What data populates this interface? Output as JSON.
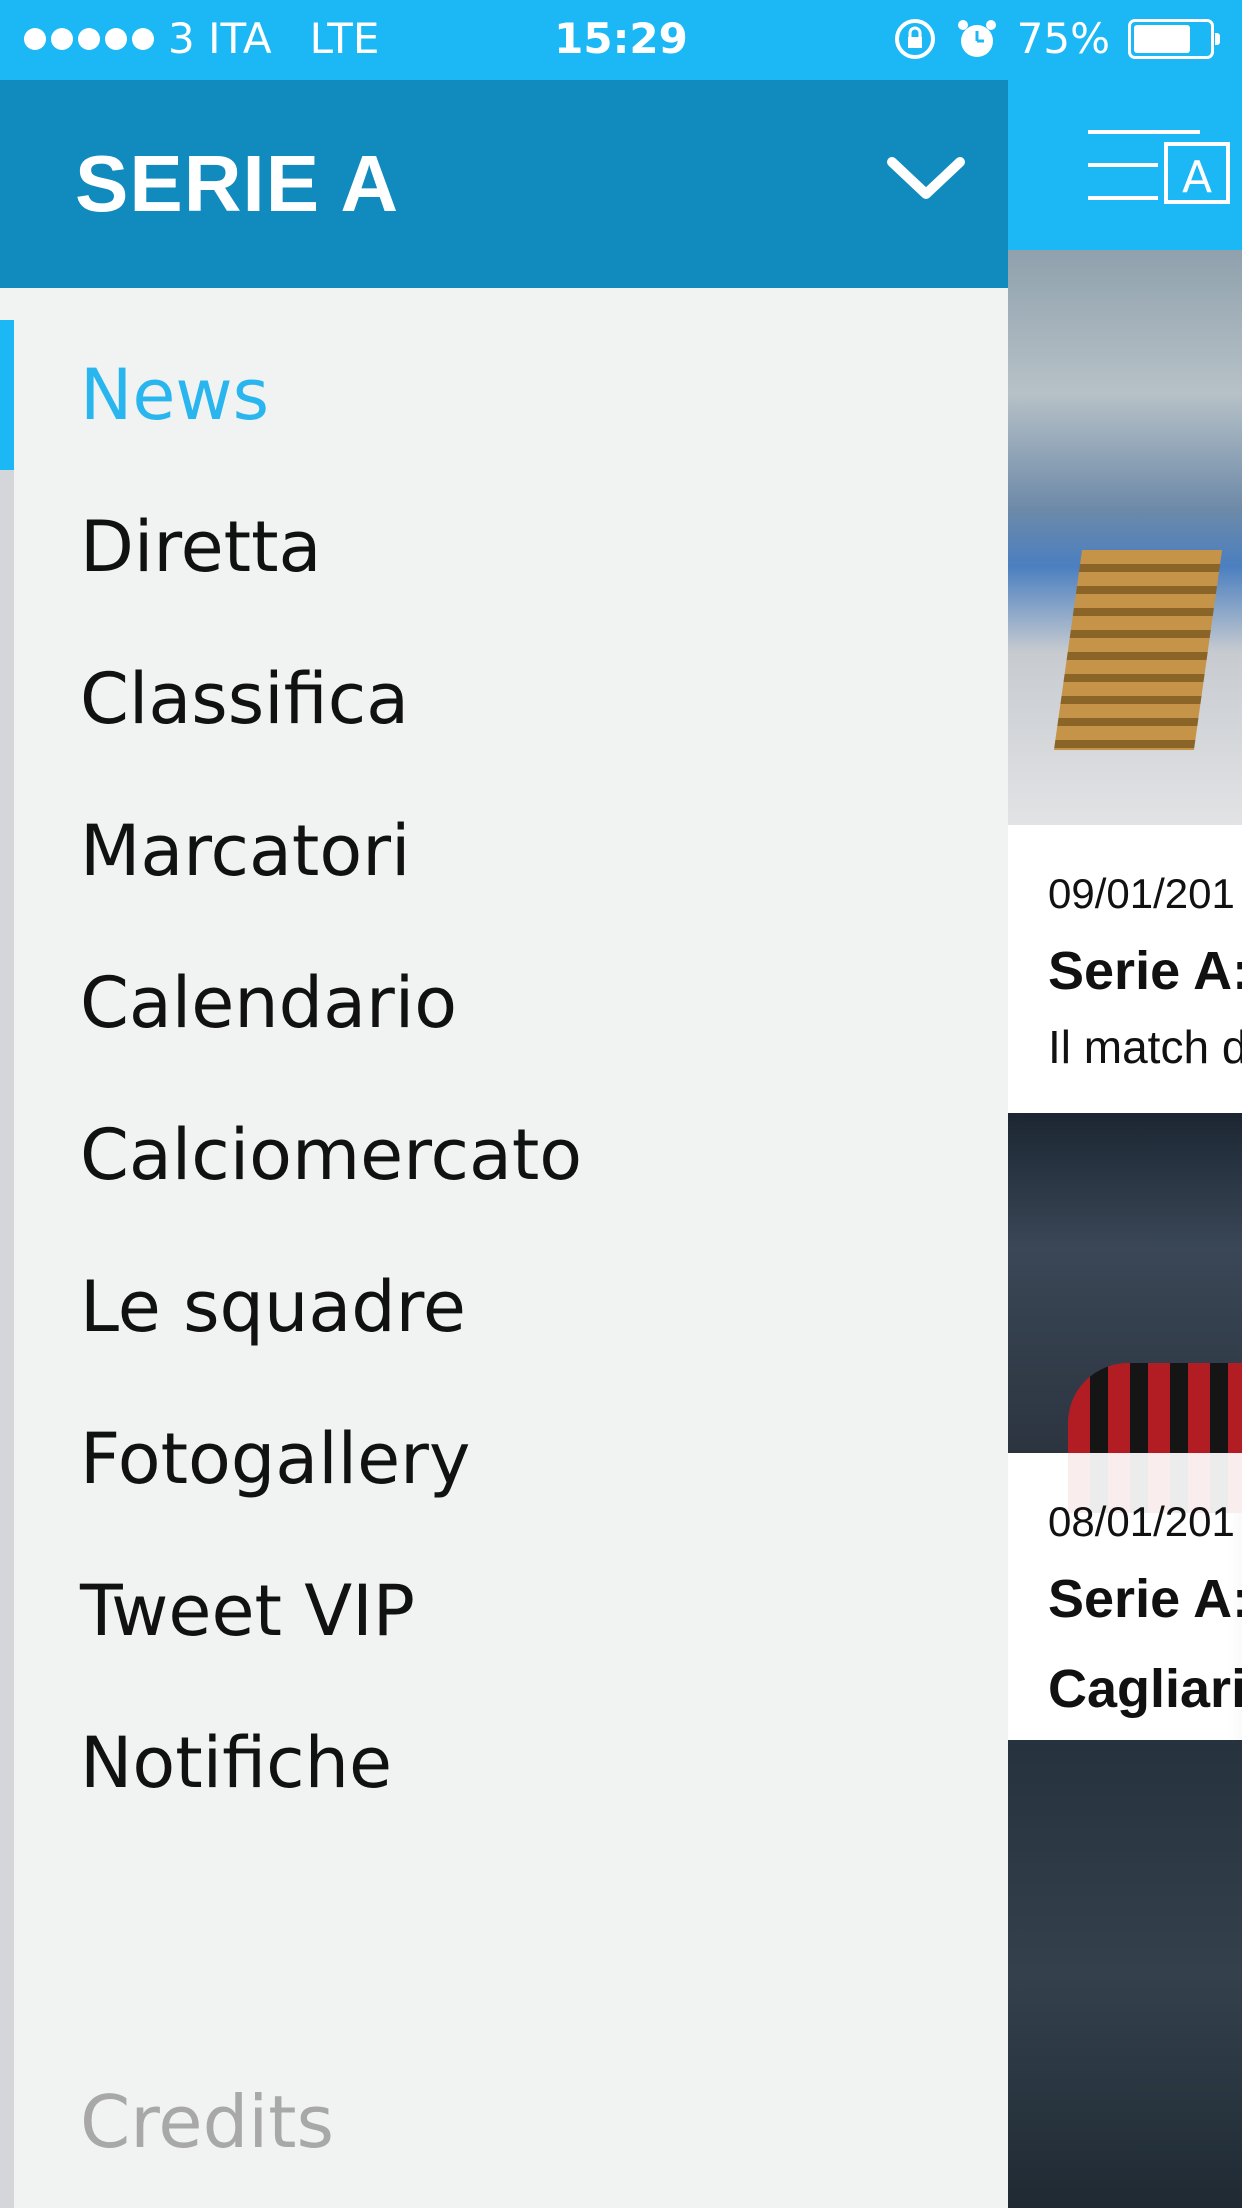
{
  "status_bar": {
    "carrier": "3 ITA",
    "network": "LTE",
    "time": "15:29",
    "battery": "75%",
    "battery_level": 0.75
  },
  "drawer": {
    "title": "SERIE A",
    "menu": [
      {
        "label": "News",
        "active": true
      },
      {
        "label": "Diretta"
      },
      {
        "label": "Classifica"
      },
      {
        "label": "Marcatori"
      },
      {
        "label": "Calendario"
      },
      {
        "label": "Calciomercato"
      },
      {
        "label": "Le squadre"
      },
      {
        "label": "Fotogallery"
      },
      {
        "label": "Tweet VIP"
      },
      {
        "label": "Notifiche"
      }
    ],
    "credits": "Credits"
  },
  "content": {
    "articles": [
      {
        "date": "09/01/201",
        "title": "Serie A:",
        "subtitle": "Il match d"
      },
      {
        "date": "08/01/201",
        "title": "Serie A:",
        "subtitle": "Cagliari,"
      }
    ]
  },
  "colors": {
    "accent": "#1bb8f5",
    "header": "#118bbd",
    "drawer_bg": "#f1f2f2",
    "active_item": "#29b6ef",
    "credits": "#a8a8a8"
  }
}
